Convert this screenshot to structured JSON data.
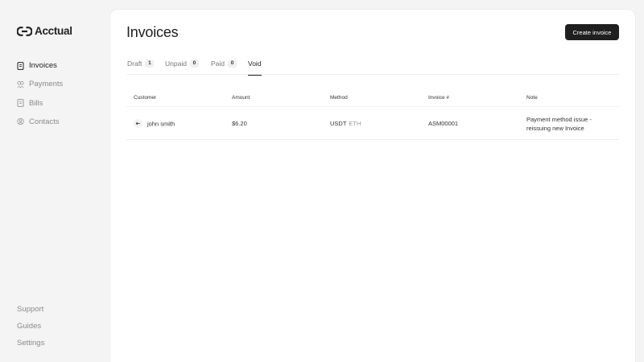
{
  "app": {
    "name": "Acctual"
  },
  "sidebar": {
    "items": [
      {
        "label": "Invoices",
        "icon": "document-icon",
        "active": true
      },
      {
        "label": "Payments",
        "icon": "payments-icon",
        "active": false
      },
      {
        "label": "Bills",
        "icon": "bill-icon",
        "active": false
      },
      {
        "label": "Contacts",
        "icon": "contacts-icon",
        "active": false
      }
    ],
    "bottom": [
      {
        "label": "Support"
      },
      {
        "label": "Guides"
      },
      {
        "label": "Settings"
      }
    ]
  },
  "main": {
    "title": "Invoices",
    "create_label": "Create invoice",
    "tabs": [
      {
        "label": "Draft",
        "count": "1"
      },
      {
        "label": "Unpaid",
        "count": "0"
      },
      {
        "label": "Paid",
        "count": "0"
      },
      {
        "label": "Void",
        "count": ""
      }
    ],
    "active_tab": "Void",
    "table": {
      "columns": [
        "Customer",
        "Amount",
        "Method",
        "Invoice #",
        "Note"
      ],
      "rows": [
        {
          "customer": "john smith",
          "amount": "$6.20",
          "method": "USDT",
          "network": "ETH",
          "invoice": "ASM00001",
          "note": "Payment method issue - reissuing new Invoice"
        }
      ]
    }
  },
  "colors": {
    "background": "#f4f4f4",
    "panel": "#ffffff",
    "primary_button": "#1f1f1f"
  }
}
